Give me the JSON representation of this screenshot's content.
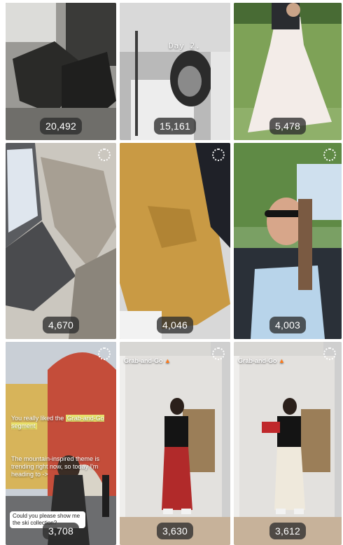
{
  "grid": {
    "tiles": [
      {
        "views": "20,492",
        "caption": "",
        "has_ring": false
      },
      {
        "views": "15,161",
        "caption": "Day 2.",
        "has_ring": false
      },
      {
        "views": "5,478",
        "caption": "",
        "has_ring": false
      },
      {
        "views": "4,670",
        "caption": "",
        "has_ring": true
      },
      {
        "views": "4,046",
        "caption": "",
        "has_ring": true
      },
      {
        "views": "4,003",
        "caption": "",
        "has_ring": true
      },
      {
        "views": "3,708",
        "caption": "",
        "has_ring": true
      },
      {
        "views": "3,630",
        "caption": "Grab-and-Go",
        "has_ring": true
      },
      {
        "views": "3,612",
        "caption": "Grab-and-Go",
        "has_ring": true
      }
    ],
    "tile7": {
      "caption1": "You really liked the",
      "caption1_highlight": "Grab-and-Go segment",
      "caption2": "The mountain-inspired theme is trending right now, so today I'm heading to ->",
      "question": "Could you please show me the ski collection?"
    }
  },
  "icons": {
    "fire": "fire-icon",
    "progress_ring": "loading-ring-icon"
  }
}
